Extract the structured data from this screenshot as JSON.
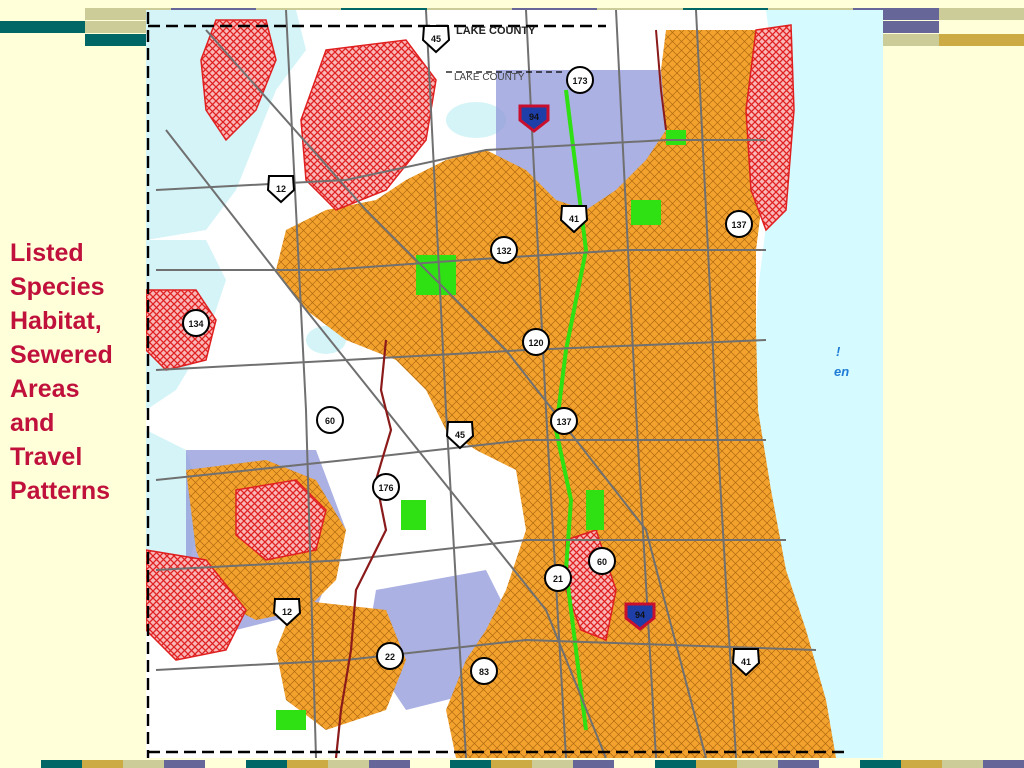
{
  "slide": {
    "title": "Listed\nSpecies\nHabitat,\nSewered\nAreas\nand\nTravel\nPatterns"
  },
  "map": {
    "county_label_top": "LAKE COUNTY",
    "county_label_inner": "LAKE COUNTY",
    "partial_label": "en",
    "partial_mark": "!",
    "colors": {
      "sewered_area": "#F3A22E",
      "listed_species_habitat": "#E02020",
      "travel_corridor": "#8F97D8",
      "lake_michigan": "#D5FAFF",
      "inland_water": "#D4F4F7",
      "green_space": "#2FE012",
      "roads": "#707070",
      "river": "#8B1A1A",
      "county_boundary": "#000000"
    },
    "route_markers": [
      {
        "id": "45",
        "type": "us",
        "label": "45"
      },
      {
        "id": "173",
        "type": "state",
        "label": "173"
      },
      {
        "id": "94a",
        "type": "interstate",
        "label": "94"
      },
      {
        "id": "41",
        "type": "us",
        "label": "41"
      },
      {
        "id": "137a",
        "type": "state",
        "label": "137"
      },
      {
        "id": "132",
        "type": "state",
        "label": "132"
      },
      {
        "id": "120",
        "type": "state",
        "label": "120"
      },
      {
        "id": "134",
        "type": "state",
        "label": "134"
      },
      {
        "id": "12a",
        "type": "us",
        "label": "12"
      },
      {
        "id": "60",
        "type": "state",
        "label": "60"
      },
      {
        "id": "45b",
        "type": "us",
        "label": "45"
      },
      {
        "id": "176",
        "type": "state",
        "label": "176"
      },
      {
        "id": "137b",
        "type": "state",
        "label": "137"
      },
      {
        "id": "60b",
        "type": "state",
        "label": "60"
      },
      {
        "id": "21",
        "type": "state",
        "label": "21"
      },
      {
        "id": "94b",
        "type": "interstate",
        "label": "94"
      },
      {
        "id": "12b",
        "type": "us",
        "label": "12"
      },
      {
        "id": "22",
        "type": "state",
        "label": "22"
      },
      {
        "id": "83",
        "type": "state",
        "label": "83"
      },
      {
        "id": "41b",
        "type": "us",
        "label": "41"
      }
    ]
  },
  "bands": {
    "top_row1": [
      "#FFFFD9",
      "#CCCC99",
      "#666699",
      "#CCCC99",
      "#006666",
      "#CCCC99",
      "#666699",
      "#CCCC99",
      "#006666",
      "#CCCC99",
      "#666699",
      "#CCCC99"
    ],
    "top_row2": [
      "#006666",
      "#CCCC99",
      "#666699",
      "#CCCC99",
      "#006666",
      "#CCCC99",
      "#666699",
      "#CCCC99",
      "#006666",
      "#CCCC99",
      "#666699",
      "#FFFFD9"
    ],
    "top_row3": [
      "#FFFFD9",
      "#006666",
      "#CCAA44",
      "#CCCC99",
      "#006666",
      "#CCCC99",
      "#006666",
      "#CCAA44",
      "#CCCC99",
      "#006666",
      "#CCCC99",
      "#CCAA44"
    ],
    "bottom": [
      "#FFFFD9",
      "#006666",
      "#CCAA44",
      "#CCCC99",
      "#666699",
      "#FFFFD9",
      "#006666",
      "#CCAA44",
      "#CCCC99",
      "#666699",
      "#FFFFD9",
      "#006666",
      "#CCAA44",
      "#CCCC99",
      "#666699",
      "#FFFFD9",
      "#006666",
      "#CCAA44",
      "#CCCC99",
      "#666699",
      "#FFFFD9",
      "#006666",
      "#CCAA44",
      "#CCCC99",
      "#666699"
    ]
  }
}
